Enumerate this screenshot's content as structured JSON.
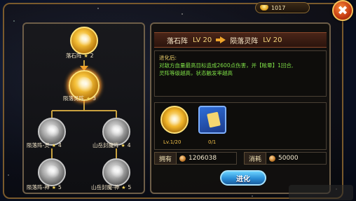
{
  "currency": {
    "amount": "1017",
    "icon": "gold-ingot-icon"
  },
  "close_label": "✖",
  "tree": {
    "nodes": [
      {
        "id": "n1",
        "name": "落石阵",
        "stars": "2",
        "state": "owned"
      },
      {
        "id": "n2",
        "name": "陨落灵阵",
        "stars": "3",
        "state": "selected"
      },
      {
        "id": "n3",
        "name": "陨落阵-灵",
        "stars": "4",
        "state": "locked"
      },
      {
        "id": "n4",
        "name": "山岳封魔阵",
        "stars": "4",
        "state": "locked"
      },
      {
        "id": "n5",
        "name": "陨落阵-神",
        "stars": "5",
        "state": "locked"
      },
      {
        "id": "n6",
        "name": "山岳封魔-神",
        "stars": "5",
        "state": "locked"
      }
    ],
    "star_glyph": "★"
  },
  "evolve": {
    "from_name": "落石阵",
    "from_lv": "LV 20",
    "to_name": "陨落灵阵",
    "to_lv": "LV 20",
    "desc_title": "进化后:",
    "desc_lines": [
      "对敌方血量最高目标造成2600点伤害，并【眩晕】1回合,",
      "灵阵等级越高，状态触发率越高"
    ],
    "materials": [
      {
        "icon": "array-book-icon",
        "count": "Lv.1/20"
      },
      {
        "icon": "blue-scroll-icon",
        "count": "0/1"
      }
    ],
    "own_label": "拥有",
    "own_value": "1206038",
    "cost_label": "消耗",
    "cost_value": "50000",
    "button_label": "进化"
  },
  "colors": {
    "accent": "#f0a52a",
    "desc_text": "#7fe047",
    "button": "#2a8ed6"
  }
}
